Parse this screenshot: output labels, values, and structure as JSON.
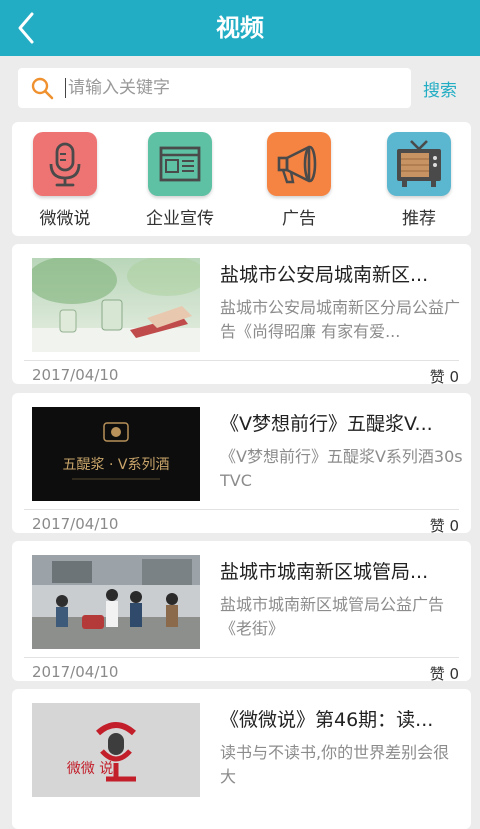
{
  "header": {
    "title": "视频",
    "back_icon": "chevron-left-icon",
    "color": "#22adc4"
  },
  "search": {
    "placeholder": "请输入关键字",
    "value": "",
    "button_label": "搜索"
  },
  "categories": [
    {
      "label": "微微说",
      "icon": "microphone-icon",
      "color": "#ee7474"
    },
    {
      "label": "企业宣传",
      "icon": "browser-window-icon",
      "color": "#5ec1a3"
    },
    {
      "label": "广告",
      "icon": "megaphone-icon",
      "color": "#f58442"
    },
    {
      "label": "推荐",
      "icon": "tv-icon",
      "color": "#5bb6cf"
    }
  ],
  "videos": [
    {
      "title": "盐城市公安局城南新区...",
      "description": "盐城市公安局城南新区分局公益广告《尚得昭廉 有家有爱...",
      "date": "2017/04/10",
      "likes": "赞 0"
    },
    {
      "title": "《V梦想前行》五醍浆V...",
      "description": "《V梦想前行》五醍浆V系列酒30s TVC",
      "date": "2017/04/10",
      "likes": "赞 0",
      "thumb_text": "五醍浆 · V系列酒"
    },
    {
      "title": "盐城市城南新区城管局...",
      "description": "盐城市城南新区城管局公益广告《老街》",
      "date": "2017/04/10",
      "likes": "赞 0"
    },
    {
      "title": "《微微说》第46期：读...",
      "description": "读书与不读书,你的世界差别会很大",
      "date": "",
      "likes": "",
      "thumb_text": "微微 说"
    }
  ]
}
